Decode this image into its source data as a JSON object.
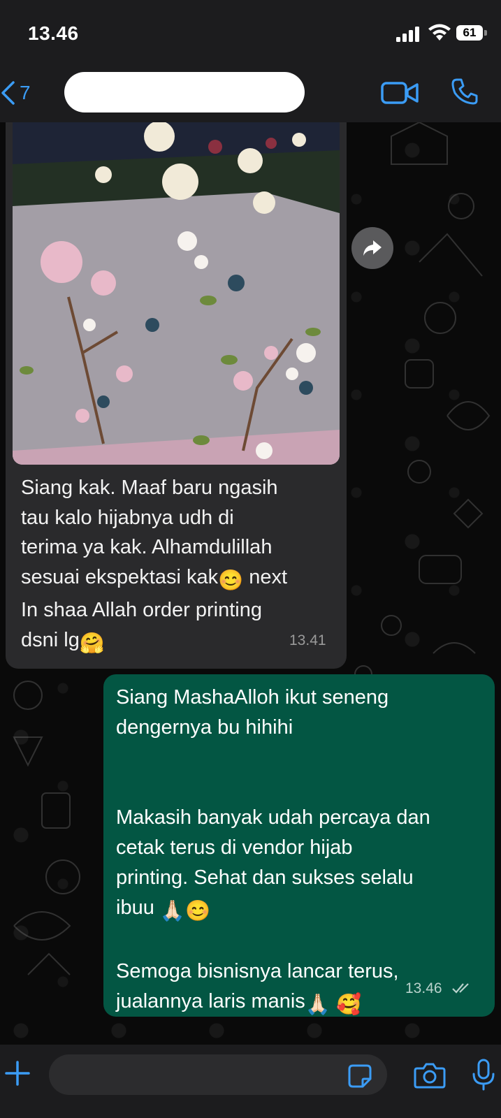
{
  "status_bar": {
    "time": "13.46",
    "battery": "61"
  },
  "header": {
    "back_count": "7",
    "contact_name": "",
    "icons": [
      "chevron-left-icon",
      "video-call-icon",
      "phone-icon"
    ]
  },
  "messages": [
    {
      "direction": "incoming",
      "has_image": true,
      "lines": [
        "Siang kak. Maaf baru ngasih",
        "tau kalo hijabnya udh di",
        "terima ya kak. Alhamdulillah",
        "sesuai ekspektasi kak",
        "next",
        "In shaa Allah order printing",
        "dsni lg"
      ],
      "emoji": [
        "😊",
        "🤗"
      ],
      "time": "13.41"
    },
    {
      "direction": "outgoing",
      "paragraphs": [
        "Siang MashaAlloh ikut seneng",
        "dengernya bu hihihi",
        "Makasih banyak udah percaya dan",
        "cetak terus di vendor hijab",
        "printing. Sehat dan sukses selalu",
        "ibuu",
        "Semoga bisnisnya lancar terus,",
        "jualannya laris manis"
      ],
      "emoji": [
        "🙏🏻",
        "😊",
        "🙏🏻",
        "🥰"
      ],
      "time": "13.46"
    }
  ],
  "colors": {
    "accent": "#3b9cf5",
    "incoming_bubble": "#2a2a2c",
    "outgoing_bubble": "#035643",
    "background": "#0a0a0a"
  },
  "input": {
    "placeholder": ""
  }
}
